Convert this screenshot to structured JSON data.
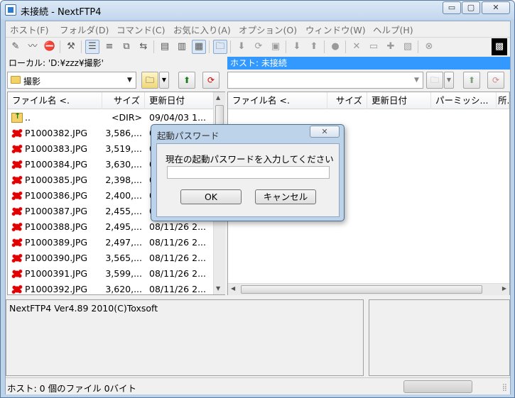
{
  "window": {
    "title": "未接続 - NextFTP4",
    "minimize_glyph": "▭",
    "maximize_glyph": "▢",
    "close_glyph": "✕"
  },
  "menu": [
    "ホスト(F)",
    "フォルダ(D)",
    "コマンド(C)",
    "お気に入り(A)",
    "オプション(O)",
    "ウィンドウ(W)",
    "ヘルプ(H)"
  ],
  "toolbar": {
    "icons": [
      "connect-icon",
      "quick-connect-icon",
      "disconnect-icon",
      "settings-icon",
      "list-view-icon",
      "sort-view-icon",
      "copy-folder-icon",
      "sync-icon",
      "text-mode-icon",
      "binary-mode-icon",
      "auto-mode-icon",
      "open-folder-icon",
      "download-icon",
      "reload-icon",
      "stop-icon",
      "arrow-down-icon",
      "arrow-up-icon",
      "delete-icon",
      "cut-icon",
      "rename-icon",
      "new-folder-icon",
      "properties-icon",
      "cancel-icon"
    ]
  },
  "local": {
    "path_label": "ローカル: 'D:¥zzz¥撮影'",
    "folder": "撮影",
    "columns": [
      "ファイル名 <.",
      "サイズ",
      "更新日付"
    ],
    "files": [
      {
        "name": "..",
        "size": "<DIR>",
        "date": "09/04/03 1...",
        "type": "up"
      },
      {
        "name": "P1000382.JPG",
        "size": "3,586,...",
        "date": "0",
        "type": "jpg"
      },
      {
        "name": "P1000383.JPG",
        "size": "3,519,...",
        "date": "0",
        "type": "jpg"
      },
      {
        "name": "P1000384.JPG",
        "size": "3,630,...",
        "date": "0",
        "type": "jpg"
      },
      {
        "name": "P1000385.JPG",
        "size": "2,398,...",
        "date": "0",
        "type": "jpg"
      },
      {
        "name": "P1000386.JPG",
        "size": "2,400,...",
        "date": "0",
        "type": "jpg"
      },
      {
        "name": "P1000387.JPG",
        "size": "2,455,...",
        "date": "0",
        "type": "jpg"
      },
      {
        "name": "P1000388.JPG",
        "size": "2,495,...",
        "date": "08/11/26 2...",
        "type": "jpg"
      },
      {
        "name": "P1000389.JPG",
        "size": "2,497,...",
        "date": "08/11/26 2...",
        "type": "jpg"
      },
      {
        "name": "P1000390.JPG",
        "size": "3,565,...",
        "date": "08/11/26 2...",
        "type": "jpg"
      },
      {
        "name": "P1000391.JPG",
        "size": "3,599,...",
        "date": "08/11/26 2...",
        "type": "jpg"
      },
      {
        "name": "P1000392.JPG",
        "size": "3,620,...",
        "date": "08/11/26 2...",
        "type": "jpg"
      }
    ]
  },
  "remote": {
    "path_label": "ホスト: 未接続",
    "columns": [
      "ファイル名 <.",
      "サイズ",
      "更新日付",
      "パーミッシ...",
      "所."
    ]
  },
  "log": {
    "text": "NextFTP4 Ver4.89 2010(C)Toxsoft"
  },
  "status": {
    "text": "ホスト: 0 個のファイル  0バイト"
  },
  "dialog": {
    "title": "起動パスワード",
    "close_glyph": "✕",
    "prompt": "現在の起動パスワードを入力してください",
    "password_value": "",
    "ok_label": "OK",
    "cancel_label": "キャンセル"
  }
}
